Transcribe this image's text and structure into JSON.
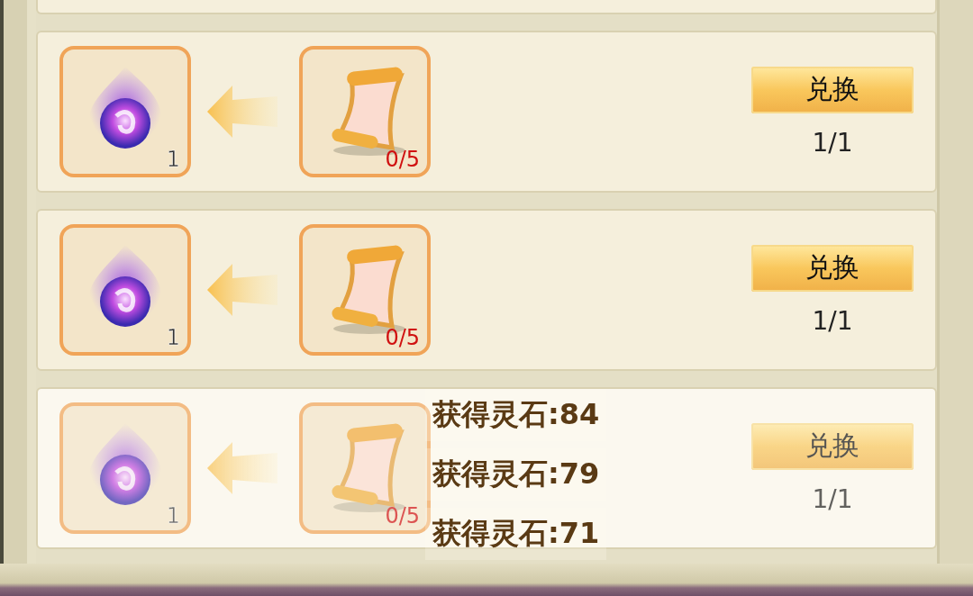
{
  "rows": [
    {
      "reward_count": "1",
      "cost": "0/5",
      "button": "兑换",
      "limit": "1/1",
      "faded": false
    },
    {
      "reward_count": "1",
      "cost": "0/5",
      "button": "兑换",
      "limit": "1/1",
      "faded": false
    },
    {
      "reward_count": "1",
      "cost": "0/5",
      "button": "兑换",
      "limit": "1/1",
      "faded": true
    }
  ],
  "toasts": [
    "获得灵石:84",
    "获得灵石:79",
    "获得灵石:71"
  ]
}
